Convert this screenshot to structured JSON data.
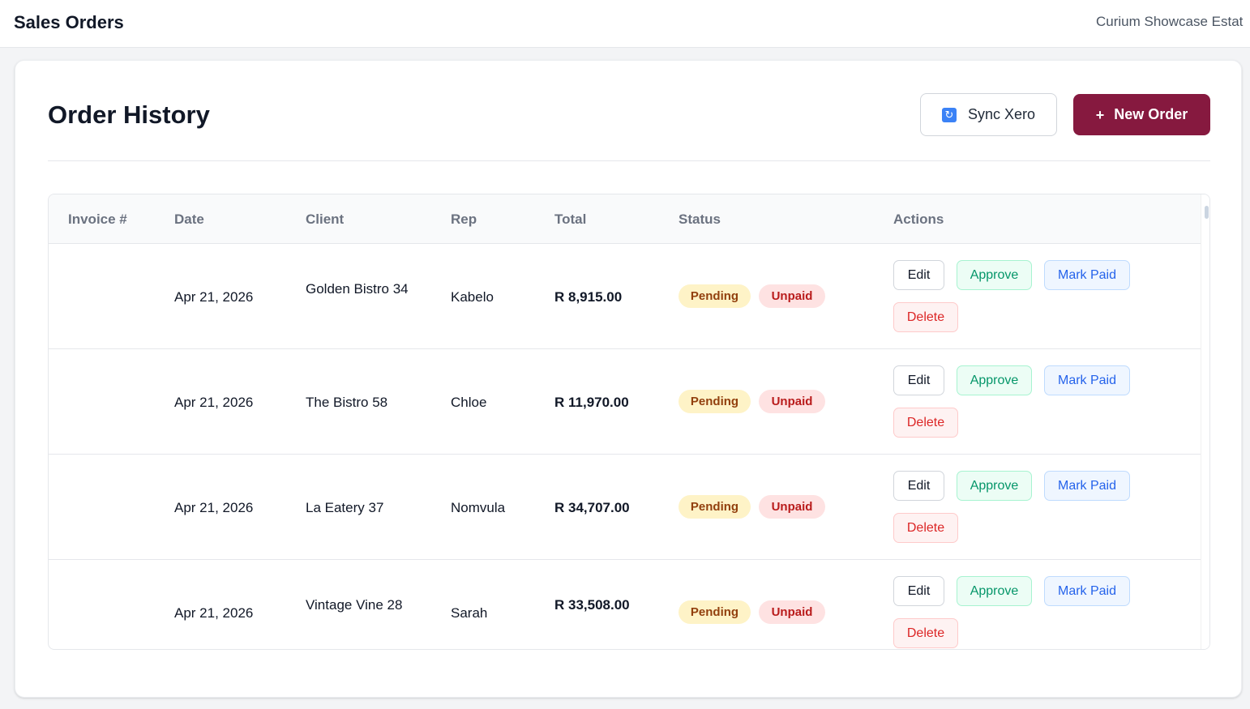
{
  "header": {
    "title": "Sales Orders",
    "organization": "Curium Showcase Estat"
  },
  "page": {
    "title": "Order History",
    "sync_label": "Sync Xero",
    "new_order_label": "New Order",
    "sync_icon": "refresh-icon",
    "new_order_icon": "plus-icon"
  },
  "table": {
    "columns": [
      "Invoice #",
      "Date",
      "Client",
      "Rep",
      "Total",
      "Status",
      "Actions"
    ],
    "rows": [
      {
        "invoice": "",
        "date": "Apr 21, 2026",
        "client": "Golden Bistro 34",
        "rep": "Kabelo",
        "total": "R 8,915.00",
        "approval_status": "Pending",
        "payment_status": "Unpaid",
        "actions": {
          "edit": "Edit",
          "approve": "Approve",
          "mark_paid": "Mark Paid",
          "delete": "Delete"
        }
      },
      {
        "invoice": "",
        "date": "Apr 21, 2026",
        "client": "The Bistro 58",
        "rep": "Chloe",
        "total": "R 11,970.00",
        "approval_status": "Pending",
        "payment_status": "Unpaid",
        "actions": {
          "edit": "Edit",
          "approve": "Approve",
          "mark_paid": "Mark Paid",
          "delete": "Delete"
        }
      },
      {
        "invoice": "",
        "date": "Apr 21, 2026",
        "client": "La Eatery 37",
        "rep": "Nomvula",
        "total": "R 34,707.00",
        "approval_status": "Pending",
        "payment_status": "Unpaid",
        "actions": {
          "edit": "Edit",
          "approve": "Approve",
          "mark_paid": "Mark Paid",
          "delete": "Delete"
        }
      },
      {
        "invoice": "",
        "date": "Apr 21, 2026",
        "client": "Vintage Vine 28",
        "rep": "Sarah",
        "total": "R 33,508.00",
        "approval_status": "Pending",
        "payment_status": "Unpaid",
        "actions": {
          "edit": "Edit",
          "approve": "Approve",
          "mark_paid": "Mark Paid",
          "delete": "Delete"
        }
      }
    ]
  },
  "colors": {
    "brand": "#86193f",
    "pending_bg": "#fef3c7",
    "unpaid_bg": "#fee2e2",
    "approve": "#059669",
    "mark_paid": "#2563eb",
    "delete": "#dc2626"
  }
}
